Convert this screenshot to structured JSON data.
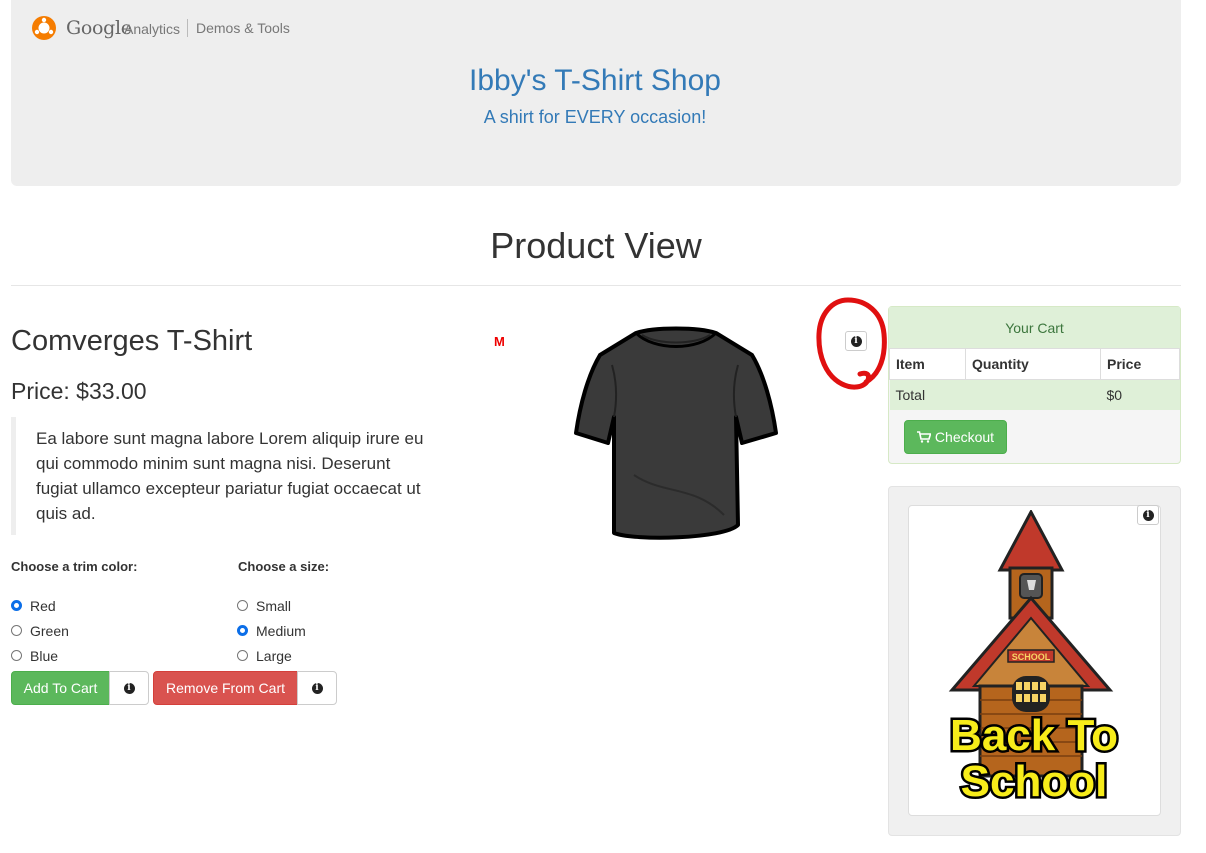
{
  "header": {
    "brand_google": "Google",
    "brand_analytics": "Analytics",
    "brand_section": "Demos & Tools",
    "shop_title": "Ibby's T-Shirt Shop",
    "shop_subtitle": "A shirt for EVERY occasion!"
  },
  "page": {
    "title": "Product View"
  },
  "product": {
    "name": "Comverges T-Shirt",
    "price": "Price: $33.00",
    "description": "Ea labore sunt magna labore Lorem aliquip irure eu qui commodo minim sunt magna nisi. Deserunt fugiat ullamco excepteur pariatur fugiat occaecat ut quis ad.",
    "size_badge": "M"
  },
  "options": {
    "trim_label": "Choose a trim color:",
    "trim_colors": [
      {
        "label": "Red",
        "selected": true
      },
      {
        "label": "Green",
        "selected": false
      },
      {
        "label": "Blue",
        "selected": false
      }
    ],
    "size_label": "Choose a size:",
    "sizes": [
      {
        "label": "Small",
        "selected": false
      },
      {
        "label": "Medium",
        "selected": true
      },
      {
        "label": "Large",
        "selected": false
      }
    ]
  },
  "actions": {
    "add_to_cart": "Add To Cart",
    "remove_from_cart": "Remove From Cart"
  },
  "cart": {
    "title": "Your Cart",
    "columns": [
      "Item",
      "Quantity",
      "Price"
    ],
    "total_label": "Total",
    "total_value": "$0",
    "checkout": "Checkout"
  },
  "promo": {
    "line1": "Back To",
    "line2": "School",
    "sign": "SCHOOL"
  },
  "colors": {
    "brand_blue": "#337ab7",
    "success_green": "#5cb85c",
    "danger_red": "#d9534f",
    "annotation_red": "#e01010"
  },
  "icons": [
    "analytics-logo-icon",
    "info-icon",
    "cart-icon",
    "tshirt-image",
    "school-image",
    "annotation-circle"
  ]
}
